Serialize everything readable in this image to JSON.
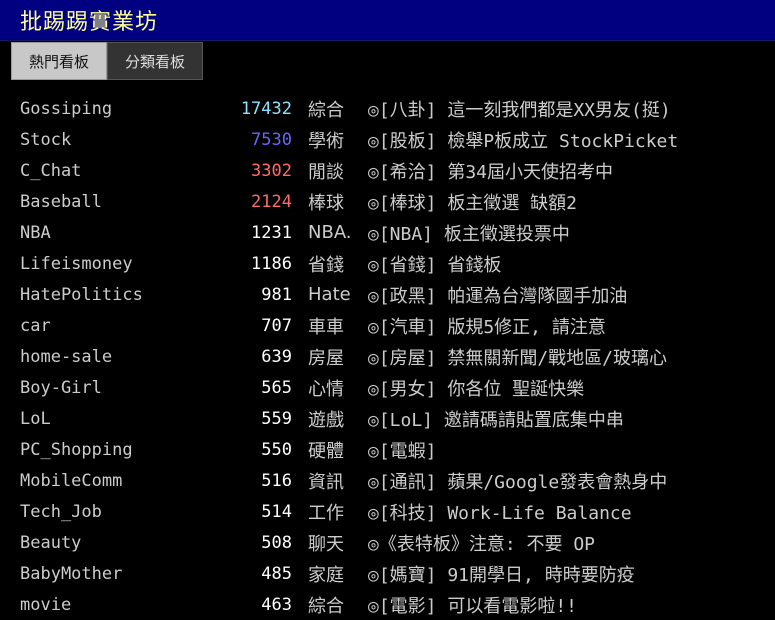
{
  "site": {
    "title": "批踢踢實業坊"
  },
  "tabs": [
    {
      "label": "熱門看板"
    },
    {
      "label": "分類看板"
    }
  ],
  "colors": {
    "header_bg": "#000080",
    "title": "#ffff9a",
    "count_cyan": "#8ae2ff",
    "count_blue": "#6666ff",
    "count_red": "#ff6b6b",
    "count_white": "#ffffff"
  },
  "boards": [
    {
      "name": "Gossiping",
      "count": "17432",
      "color": "#8ae2ff",
      "category": "綜合",
      "title": "◎[八卦] 這一刻我們都是XX男友(挺)"
    },
    {
      "name": "Stock",
      "count": "7530",
      "color": "#6666ff",
      "category": "學術",
      "title": "◎[股板] 檢舉P板成立 StockPicket"
    },
    {
      "name": "C_Chat",
      "count": "3302",
      "color": "#ff6b6b",
      "category": "閒談",
      "title": "◎[希洽] 第34屆小天使招考中"
    },
    {
      "name": "Baseball",
      "count": "2124",
      "color": "#ff6b6b",
      "category": "棒球",
      "title": "◎[棒球] 板主徵選 缺額2"
    },
    {
      "name": "NBA",
      "count": "1231",
      "color": "#ffffff",
      "category": "NBA.",
      "title": "◎[NBA] 板主徵選投票中"
    },
    {
      "name": "Lifeismoney",
      "count": "1186",
      "color": "#ffffff",
      "category": "省錢",
      "title": "◎[省錢] 省錢板"
    },
    {
      "name": "HatePolitics",
      "count": "981",
      "color": "#ffffff",
      "category": "Hate",
      "title": "◎[政黑] 帕運為台灣隊國手加油"
    },
    {
      "name": "car",
      "count": "707",
      "color": "#ffffff",
      "category": "車車",
      "title": "◎[汽車] 版規5修正, 請注意"
    },
    {
      "name": "home-sale",
      "count": "639",
      "color": "#ffffff",
      "category": "房屋",
      "title": "◎[房屋] 禁無關新聞/戰地區/玻璃心"
    },
    {
      "name": "Boy-Girl",
      "count": "565",
      "color": "#ffffff",
      "category": "心情",
      "title": "◎[男女] 你各位 聖誕快樂"
    },
    {
      "name": "LoL",
      "count": "559",
      "color": "#ffffff",
      "category": "遊戲",
      "title": "◎[LoL] 邀請碼請貼置底集中串"
    },
    {
      "name": "PC_Shopping",
      "count": "550",
      "color": "#ffffff",
      "category": "硬體",
      "title": "◎[電蝦]"
    },
    {
      "name": "MobileComm",
      "count": "516",
      "color": "#ffffff",
      "category": "資訊",
      "title": "◎[通訊] 蘋果/Google發表會熱身中"
    },
    {
      "name": "Tech_Job",
      "count": "514",
      "color": "#ffffff",
      "category": "工作",
      "title": "◎[科技] Work-Life Balance"
    },
    {
      "name": "Beauty",
      "count": "508",
      "color": "#ffffff",
      "category": "聊天",
      "title": "◎《表特板》注意: 不要 OP"
    },
    {
      "name": "BabyMother",
      "count": "485",
      "color": "#ffffff",
      "category": "家庭",
      "title": "◎[媽寶] 91開學日, 時時要防疫"
    },
    {
      "name": "movie",
      "count": "463",
      "color": "#ffffff",
      "category": "綜合",
      "title": "◎[電影] 可以看電影啦!!"
    }
  ]
}
